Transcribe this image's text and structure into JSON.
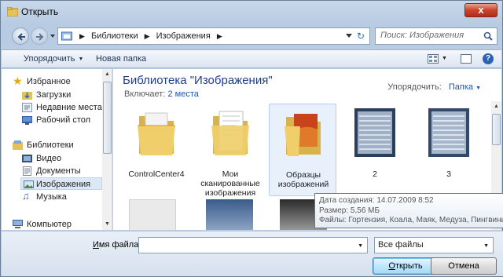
{
  "window": {
    "title": "Открыть",
    "close_glyph": "x"
  },
  "address": {
    "crumbs": [
      "Библиотеки",
      "Изображения"
    ],
    "search_placeholder": "Поиск: Изображения"
  },
  "toolbar": {
    "organize": "Упорядочить",
    "new_folder": "Новая папка",
    "help": "?"
  },
  "sidebar": {
    "favorites": {
      "label": "Избранное",
      "items": [
        "Загрузки",
        "Недавние места",
        "Рабочий стол"
      ]
    },
    "libraries": {
      "label": "Библиотеки",
      "items": [
        "Видео",
        "Документы",
        "Изображения",
        "Музыка"
      ],
      "selected": "Изображения"
    },
    "computer": {
      "label": "Компьютер"
    }
  },
  "library": {
    "title": "Библиотека \"Изображения\"",
    "includes_prefix": "Включает:",
    "includes_link": "2 места",
    "arrange_label": "Упорядочить:",
    "arrange_value": "Папка"
  },
  "items": [
    {
      "label": "ControlCenter4",
      "kind": "folder"
    },
    {
      "label": "Мои сканированные изображения",
      "kind": "folder-docs"
    },
    {
      "label": "Образцы изображений",
      "kind": "folder-photo",
      "selected": true
    },
    {
      "label": "2",
      "kind": "scan"
    },
    {
      "label": "3",
      "kind": "scan"
    }
  ],
  "tooltip": {
    "created": "Дата создания: 14.07.2009 8:52",
    "size": "Размер: 5,56 МБ",
    "files": "Файлы: Гортензия, Коала, Маяк, Медуза, Пингвины, Т"
  },
  "footer": {
    "filename_label_underlined": "И",
    "filename_label_rest": "мя файла:",
    "filename_value": "",
    "filter_value": "Все файлы",
    "open_underlined": "О",
    "open_rest": "ткрыть",
    "cancel": "Отмена"
  },
  "colors": {
    "accent": "#1e3f8a",
    "link": "#1a55b9",
    "selection": "#dde8f5",
    "close": "#c9442a"
  }
}
